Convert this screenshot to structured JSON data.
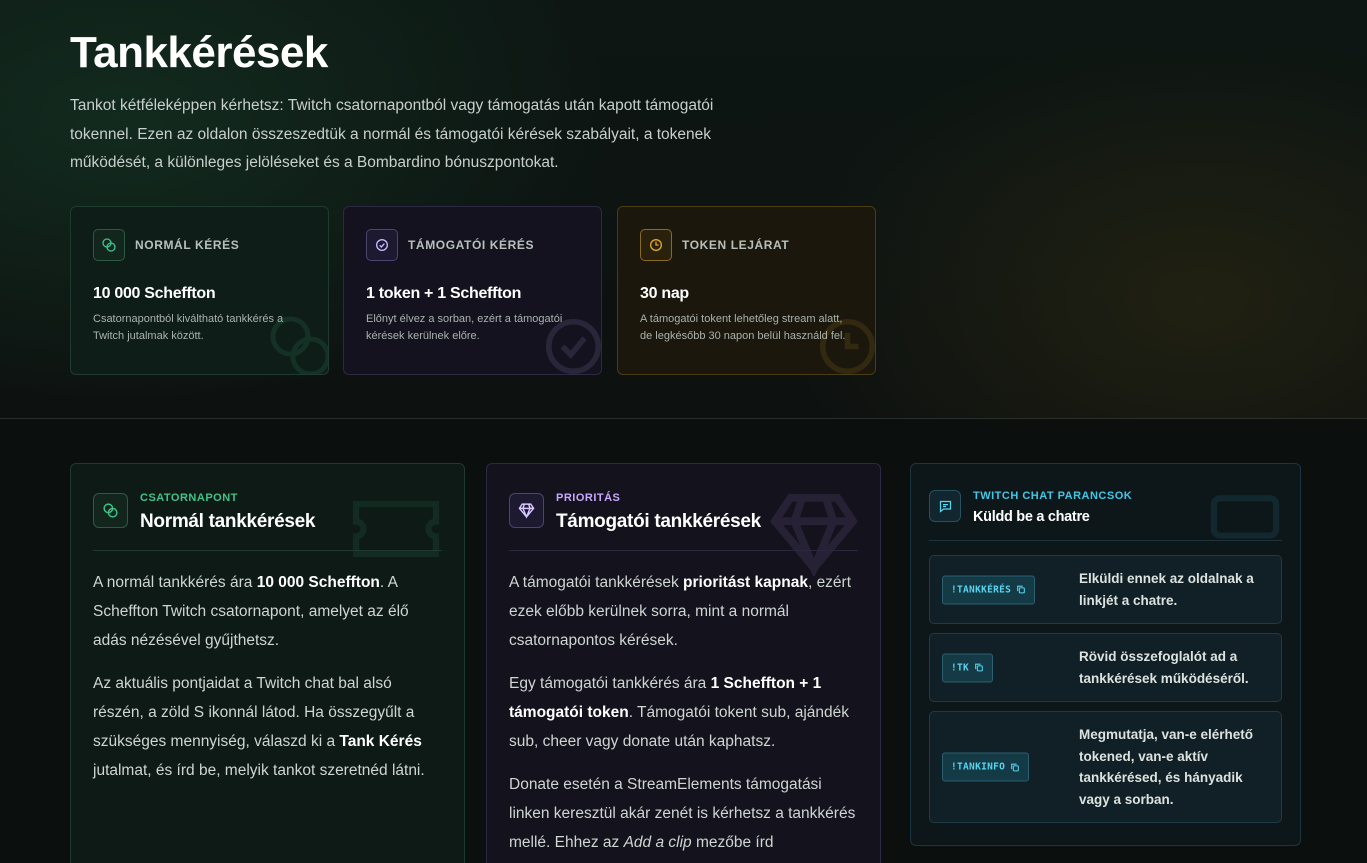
{
  "hero": {
    "title": "Tankkérések",
    "description": "Tankot kétféleképpen kérhetsz: Twitch csatornapontból vagy támogatás után kapott támogatói tokennel. Ezen az oldalon összeszedtük a normál és támogatói kérések szabályait, a tokenek működését, a különleges jelöléseket és a Bombardino bónuszpontokat."
  },
  "stats": [
    {
      "label": "NORMÁL KÉRÉS",
      "value": "10 000 Scheffton",
      "desc": "Csatornapontból kiváltható tankkérés a Twitch jutalmak között.",
      "icon": "coins-icon"
    },
    {
      "label": "TÁMOGATÓI KÉRÉS",
      "value": "1 token + 1 Scheffton",
      "desc": "Előnyt élvez a sorban, ezért a támogatói kérések kerülnek előre.",
      "icon": "badge-check-icon"
    },
    {
      "label": "TOKEN LEJÁRAT",
      "value": "30 nap",
      "desc": "A támogatói tokent lehetőleg stream alatt, de legkésőbb 30 napon belül használd fel.",
      "icon": "clock-icon"
    }
  ],
  "normal": {
    "kicker": "CSATORNAPONT",
    "title": "Normál tankkérések",
    "p1_a": "A normál tankkérés ára ",
    "p1_b": "10 000 Scheffton",
    "p1_c": ". A Scheffton Twitch csatornapont, amelyet az élő adás nézésével gyűjthetsz.",
    "p2_a": "Az aktuális pontjaidat a Twitch chat bal alsó részén, a zöld S ikonnál látod. Ha összegyűlt a szükséges mennyiség, válaszd ki a ",
    "p2_b": "Tank Kérés",
    "p2_c": " jutalmat, és írd be, melyik tankot szeretnéd látni."
  },
  "supporter": {
    "kicker": "PRIORITÁS",
    "title": "Támogatói tankkérések",
    "p1_a": "A támogatói tankkérések ",
    "p1_b": "prioritást kapnak",
    "p1_c": ", ezért ezek előbb kerülnek sorra, mint a normál csatornapontos kérések.",
    "p2_a": "Egy támogatói tankkérés ára ",
    "p2_b": "1 Scheffton + 1 támogatói token",
    "p2_c": ". Támogatói tokent sub, ajándék sub, cheer vagy donate után kaphatsz.",
    "p3_a": "Donate esetén a StreamElements támogatási linken keresztül akár zenét is kérhetsz a tankkérés mellé. Ehhez az ",
    "p3_b": "Add a clip",
    "p3_c": " mezőbe írd"
  },
  "commands": {
    "kicker": "TWITCH CHAT PARANCSOK",
    "title": "Küldd be a chatre",
    "items": [
      {
        "cmd": "!TANKKÉRÉS",
        "desc": "Elküldi ennek az oldalnak a linkjét a chatre."
      },
      {
        "cmd": "!TK",
        "desc": "Rövid összefoglalót ad a tankkérések működéséről."
      },
      {
        "cmd": "!TANKINFO",
        "desc": "Megmutatja, van-e elérhető tokened, van-e aktív tankkérésed, és hányadik vagy a sorban."
      }
    ]
  },
  "colors": {
    "green_accent": "#3ec48a",
    "purple_accent": "#c8a8ff",
    "gold_accent": "#e0a830",
    "cyan_accent": "#40c8e8"
  }
}
